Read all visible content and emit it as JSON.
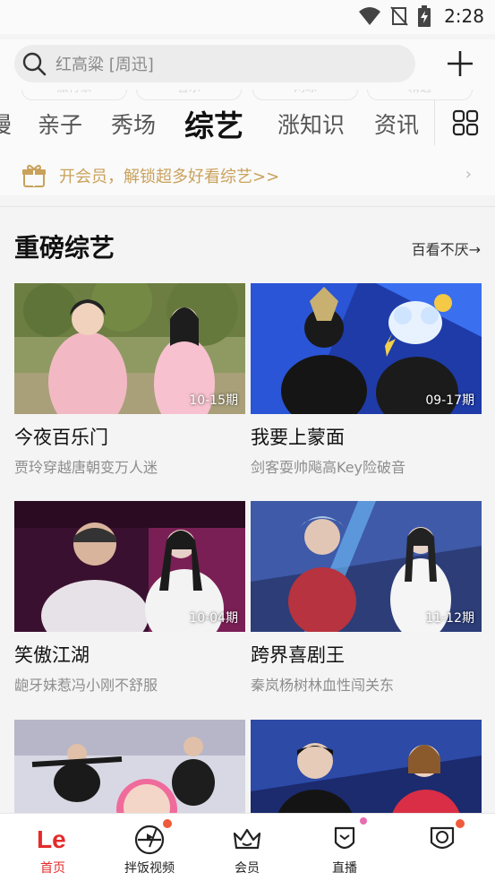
{
  "status_bar": {
    "time": "2:28"
  },
  "search": {
    "placeholder": "红高粱 [周迅]"
  },
  "tabs": {
    "items": [
      "漫",
      "亲子",
      "秀场",
      "综艺",
      "涨知识",
      "资讯"
    ],
    "active": "综艺",
    "ghost_items": [
      "旅行家",
      "音乐",
      "网球",
      "精选"
    ]
  },
  "vip_banner": {
    "text": "开会员，解锁超多好看综艺>>"
  },
  "section": {
    "title": "重磅综艺",
    "more": "百看不厌→"
  },
  "cards": [
    {
      "title": "今夜百乐门",
      "subtitle": "贾玲穿越唐朝变万人迷",
      "episode": "10-15期"
    },
    {
      "title": "我要上蒙面",
      "subtitle": "剑客耍帅飚高Key险破音",
      "episode": "09-17期"
    },
    {
      "title": "笑傲江湖",
      "subtitle": "龅牙妹惹冯小刚不舒服",
      "episode": "10-04期"
    },
    {
      "title": "跨界喜剧王",
      "subtitle": "秦岚杨树林血性闯关东",
      "episode": "11-12期"
    },
    {
      "title": "",
      "subtitle": "",
      "episode": ""
    },
    {
      "title": "",
      "subtitle": "",
      "episode": ""
    }
  ],
  "bottom_nav": [
    {
      "label": "首页",
      "icon": "le-logo-icon",
      "active": true
    },
    {
      "label": "拌饭视频",
      "icon": "bowl-icon",
      "badge": true
    },
    {
      "label": "会员",
      "icon": "crown-icon"
    },
    {
      "label": "直播",
      "icon": "live-icon",
      "badge": true
    },
    {
      "label": "",
      "icon": "profile-icon",
      "badge": true
    }
  ],
  "colors": {
    "accent_red": "#e52a2a",
    "vip_gold": "#c9a15b",
    "badge": "#ef5b3a"
  }
}
